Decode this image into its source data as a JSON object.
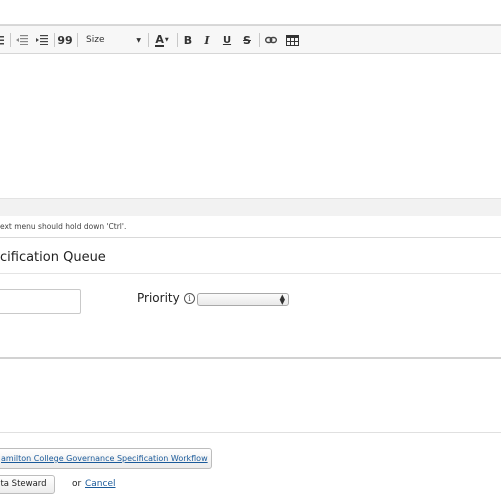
{
  "toolbar": {
    "items": [
      {
        "icon": "list-icon"
      },
      {
        "icon": "decrease-indent-icon"
      },
      {
        "icon": "increase-indent-icon"
      },
      {
        "icon": "blockquote-icon",
        "label": "99"
      },
      {
        "icon": "font-size-dropdown",
        "label": "Size"
      },
      {
        "icon": "text-color-icon",
        "label": "A"
      },
      {
        "icon": "bold-icon",
        "label": "B"
      },
      {
        "icon": "italic-icon",
        "label": "I"
      },
      {
        "icon": "underline-icon",
        "label": "U"
      },
      {
        "icon": "strikethrough-icon",
        "label": "S"
      },
      {
        "icon": "link-icon"
      },
      {
        "icon": "table-icon"
      }
    ]
  },
  "editor": {
    "hint": "ext menu should hold down 'Ctrl'."
  },
  "section": {
    "title": "cification Queue"
  },
  "form": {
    "priority_label": "Priority",
    "priority_info": "i",
    "priority_value": ""
  },
  "actions": {
    "workflow_button": "amilton College Governance Specification Workflow",
    "steward_button": "ta Steward",
    "or_text": "or",
    "cancel_link": "Cancel"
  },
  "colors": {
    "link": "#1a5a9a",
    "toolbar_bg": "#f7f7f7",
    "border": "#d9d9d9"
  }
}
